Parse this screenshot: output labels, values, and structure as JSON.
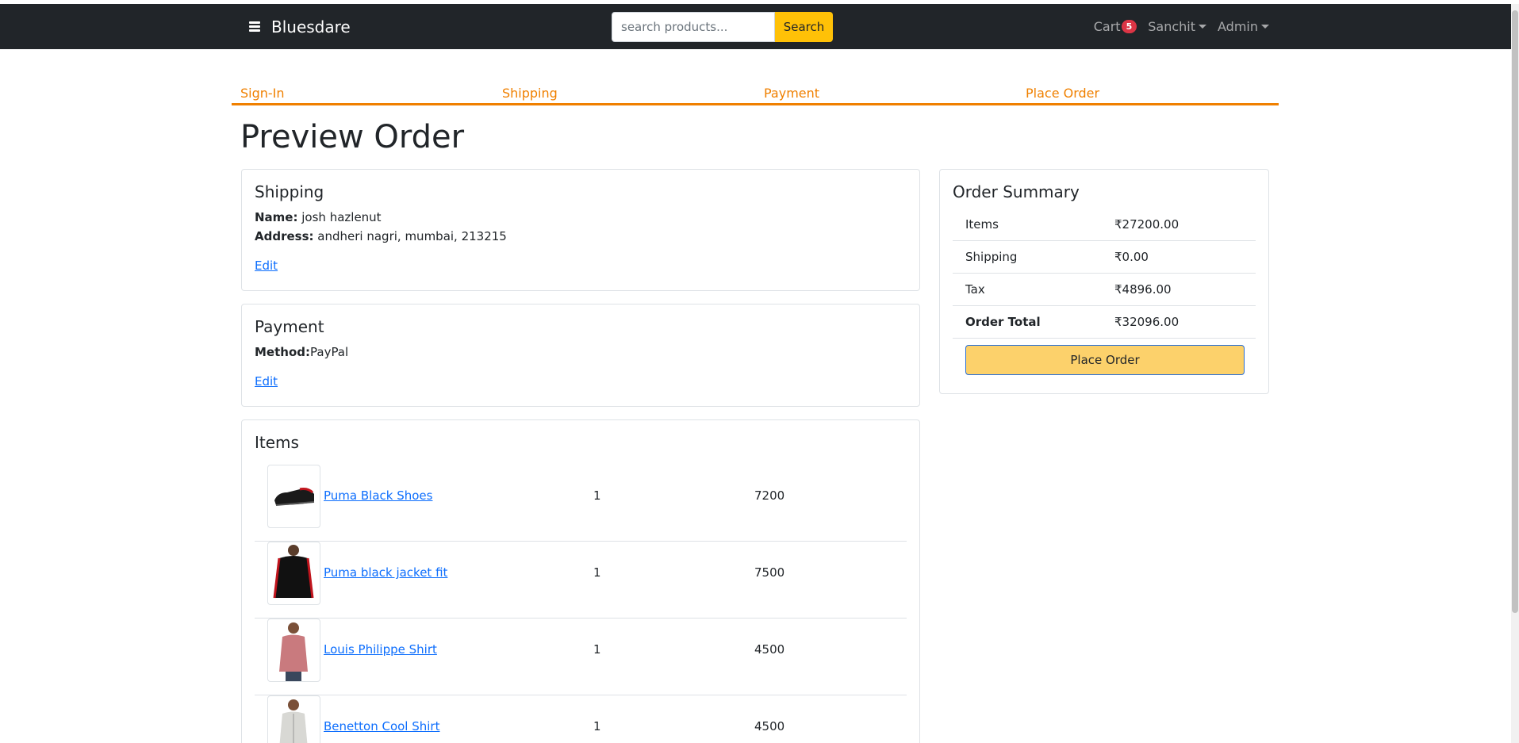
{
  "navbar": {
    "brand": "Bluesdare",
    "search_placeholder": "search products...",
    "search_button": "Search",
    "cart_label": "Cart",
    "cart_count": "5",
    "user_menu": "Sanchit",
    "admin_menu": "Admin"
  },
  "steps": [
    "Sign-In",
    "Shipping",
    "Payment",
    "Place Order"
  ],
  "page_title": "Preview Order",
  "shipping": {
    "title": "Shipping",
    "name_label": "Name:",
    "name_value": "josh hazlenut",
    "address_label": "Address:",
    "address_value": "andheri nagri, mumbai, 213215",
    "edit": "Edit"
  },
  "payment": {
    "title": "Payment",
    "method_label": "Method:",
    "method_value": "PayPal",
    "edit": "Edit"
  },
  "items": {
    "title": "Items",
    "rows": [
      {
        "name": "Puma Black Shoes",
        "qty": "1",
        "price": "7200",
        "image_icon": "shoe-icon"
      },
      {
        "name": "Puma black jacket fit",
        "qty": "1",
        "price": "7500",
        "image_icon": "jacket-icon"
      },
      {
        "name": "Louis Philippe Shirt",
        "qty": "1",
        "price": "4500",
        "image_icon": "shirt-icon"
      },
      {
        "name": "Benetton Cool Shirt",
        "qty": "1",
        "price": "4500",
        "image_icon": "shirt-icon"
      }
    ]
  },
  "summary": {
    "title": "Order Summary",
    "rows": [
      {
        "label": "Items",
        "value": "₹27200.00"
      },
      {
        "label": "Shipping",
        "value": "₹0.00"
      },
      {
        "label": "Tax",
        "value": "₹4896.00"
      },
      {
        "label": "Order Total",
        "value": "₹32096.00"
      }
    ],
    "place_order": "Place Order"
  },
  "colors": {
    "navbar_bg": "#212529",
    "accent_orange": "#f08000",
    "search_btn": "#ffc107",
    "place_btn": "#fcd16b",
    "link": "#0d6efd",
    "badge": "#dc3545"
  }
}
